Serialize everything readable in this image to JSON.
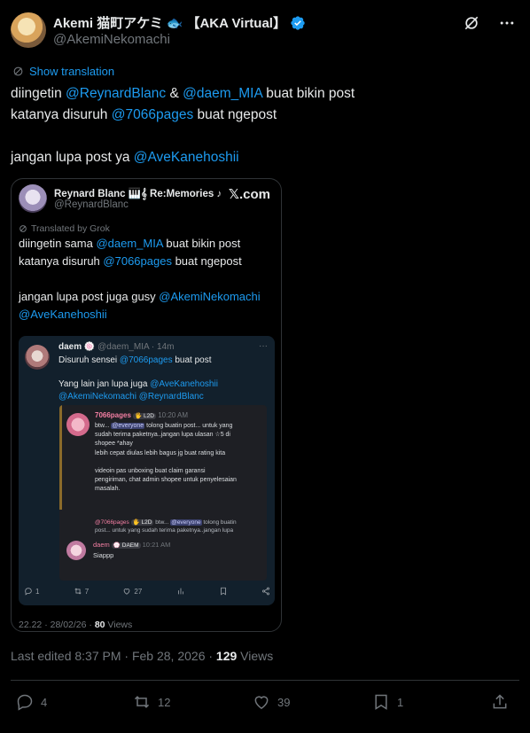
{
  "author": {
    "name": "Akemi 猫町アケミ",
    "fish": "🐟",
    "tag": "【AKA Virtual】",
    "handle": "@AkemiNekomachi"
  },
  "show_translation": "Show translation",
  "tweet": {
    "l1_a": "diingetin ",
    "l1_m1": "@ReynardBlanc",
    "l1_b": " & ",
    "l1_m2": "@daem_MIA",
    "l1_c": " buat bikin post",
    "l2_a": "katanya disuruh ",
    "l2_m1": "@7066pages",
    "l2_b": " buat ngepost",
    "l4_a": "jangan lupa post ya ",
    "l4_m1": "@AveKanehoshii"
  },
  "quote": {
    "name": "Reynard Blanc 🎹𝄞 Re:Memories ♪",
    "handle": "@ReynardBlanc",
    "xcom": "𝕏.com",
    "translated": "Translated by Grok",
    "l1_a": "diingetin sama ",
    "l1_m1": "@daem_MIA",
    "l1_b": " buat bikin post",
    "l2_a": "katanya disuruh ",
    "l2_m1": "@7066pages",
    "l2_b": " buat ngepost",
    "l4_a": "jangan lupa post juga gusy ",
    "l4_m1": "@AkemiNekomachi",
    "l5_m1": "@AveKanehoshii",
    "time": "22.22 · 28/02/26 · ",
    "views_num": "80",
    "views_label": " Views"
  },
  "embedded": {
    "name": "daem 🍥",
    "handle_time": " @daem_MIA · 14m",
    "more": "···",
    "t1_a": "Disuruh sensei ",
    "t1_m": "@7066pages",
    "t1_b": " buat post",
    "t3_a": "Yang lain jan lupa juga ",
    "t3_m1": "@AveKanehoshii",
    "t4_m1": "@AkemiNekomachi",
    "t4_m2": " @ReynardBlanc",
    "replies": "1",
    "retweets": "7",
    "likes": "27"
  },
  "discord": {
    "name": "7066pages",
    "badge": "🖐 L2D",
    "time": "10:20 AM",
    "m1_a": "btw... ",
    "m1_ev": "@everyone",
    "m1_b": " tolong buatin post... untuk yang",
    "m2": "sudah terima paketnya..jangan lupa ulasan ☆5 di",
    "m3": "shopee *ahay",
    "m4": "lebih cepat diulas lebih bagus jg buat rating kita",
    "m6": " videoin pas unboxing buat claim garansi",
    "m7": "pengiriman, chat admin shopee untuk penyelesaian",
    "m8": "masalah.",
    "r_name": "@7066pages",
    "r_badge": "🖐 L2D",
    "r_a": " btw... ",
    "r_ev": "@everyone",
    "r_b": " tolong buatin",
    "r_2": "post... untuk yang sudah terima paketnya..jangan lupa",
    "n2_name": "daem",
    "n2_badge": "💮 DAEM",
    "n2_time": "10:21 AM",
    "n2_text": "Siappp"
  },
  "edited": {
    "text": "Last edited 8:37 PM · Feb 28, 2026 · ",
    "views_num": "129",
    "views_label": " Views"
  },
  "actions": {
    "replies": "4",
    "retweets": "12",
    "likes": "39",
    "bookmarks": "1"
  }
}
